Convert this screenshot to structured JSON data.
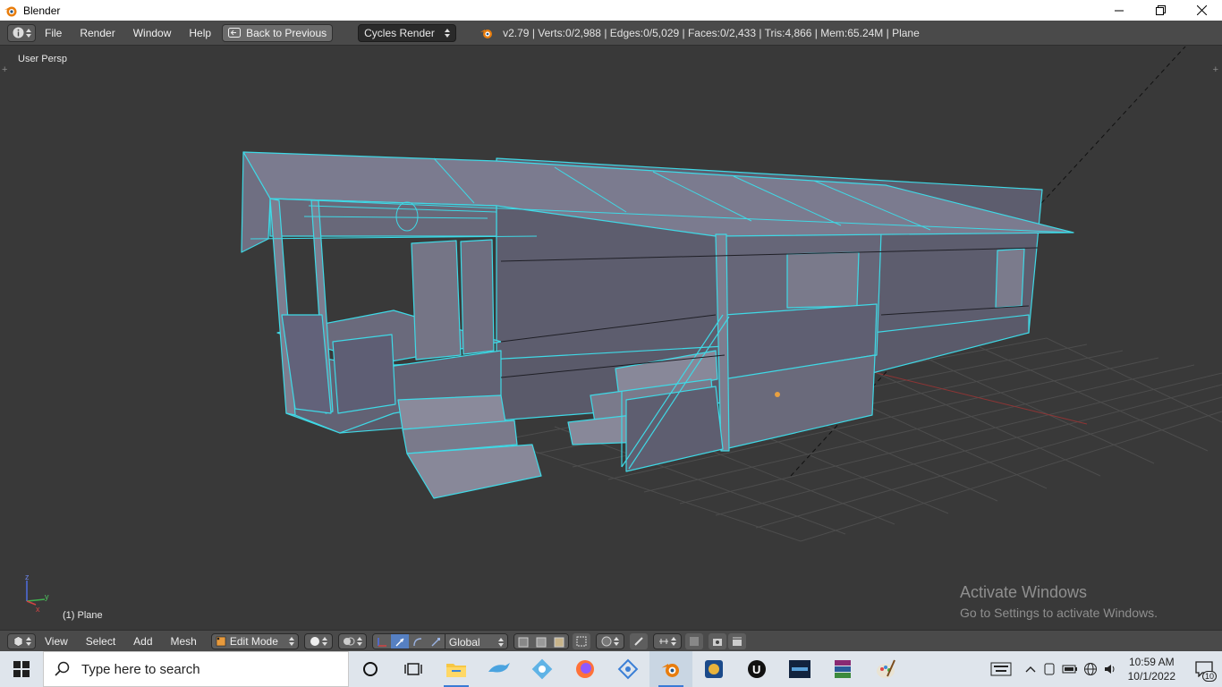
{
  "window": {
    "title": "Blender"
  },
  "info_header": {
    "menus": [
      "File",
      "Render",
      "Window",
      "Help"
    ],
    "back_button": "Back to Previous",
    "render_engine": "Cycles Render",
    "stats": "v2.79 | Verts:0/2,988 | Edges:0/5,029 | Faces:0/2,433 | Tris:4,866 | Mem:65.24M | Plane"
  },
  "viewport": {
    "view_label": "User Persp",
    "object_label": "(1) Plane",
    "axis_labels": {
      "x": "x",
      "y": "y",
      "z": "z"
    },
    "watermark_title": "Activate Windows",
    "watermark_subtitle": "Go to Settings to activate Windows."
  },
  "view_header": {
    "menus": [
      "View",
      "Select",
      "Add",
      "Mesh"
    ],
    "mode": "Edit Mode",
    "transform_orientation": "Global"
  },
  "taskbar": {
    "search_placeholder": "Type here to search",
    "apps": [
      "cortana-icon",
      "task-view-icon",
      "file-explorer-icon",
      "dolphin-icon",
      "snowflake-app-icon",
      "firefox-icon",
      "vpn-app-icon",
      "blender-icon",
      "media-player-icon",
      "unreal-engine-icon",
      "game-launcher-icon",
      "winrar-icon",
      "paint-icon"
    ],
    "time": "10:59 AM",
    "date": "10/1/2022",
    "notification_count": "10"
  },
  "colors": {
    "viewport_bg": "#393939",
    "header_bg": "#4a4a4a",
    "wire_selected": "#3fd9e6",
    "face_gray": "#6b6b7d",
    "grid": "#4c4c4c",
    "axis_x": "#9a3434",
    "active_tool": "#5680c2"
  }
}
